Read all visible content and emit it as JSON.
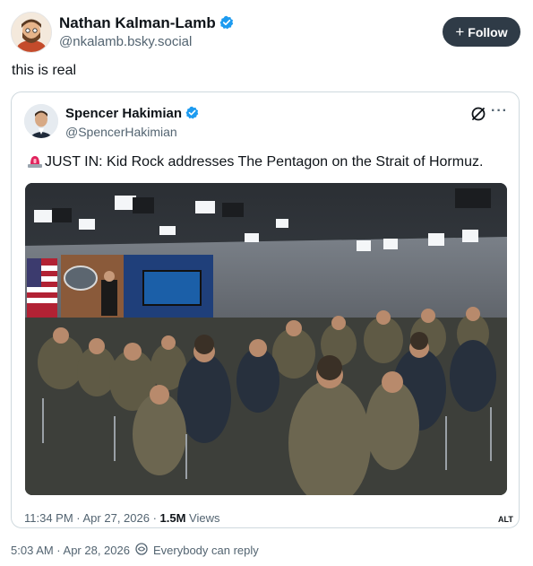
{
  "post": {
    "author_name": "Nathan Kalman-Lamb",
    "author_handle": "@nkalamb.bsky.social",
    "follow_label": "Follow",
    "follow_icon": "+",
    "text": "this is real",
    "timestamp": "5:03 AM · Apr 28, 2026",
    "reply_setting": "Everybody can reply"
  },
  "quote": {
    "author_name": "Spencer Hakimian",
    "author_handle": "@SpencerHakimian",
    "text": "JUST IN: Kid Rock addresses The Pentagon on the Strait of Hormuz.",
    "time": "11:34 PM · Apr 27, 2026 · ",
    "views_count": "1.5M",
    "views_label": " Views",
    "alt_badge": "ALT"
  },
  "colors": {
    "verified": "#1d9bf0",
    "follow_bg": "#2f3b47",
    "secondary_text": "#536471",
    "border": "#cfd9de"
  },
  "icons": [
    "verified-badge-icon",
    "plus-icon",
    "bluesky-logo-icon",
    "more-options-icon",
    "siren-emoji-icon",
    "reply-settings-icon"
  ]
}
